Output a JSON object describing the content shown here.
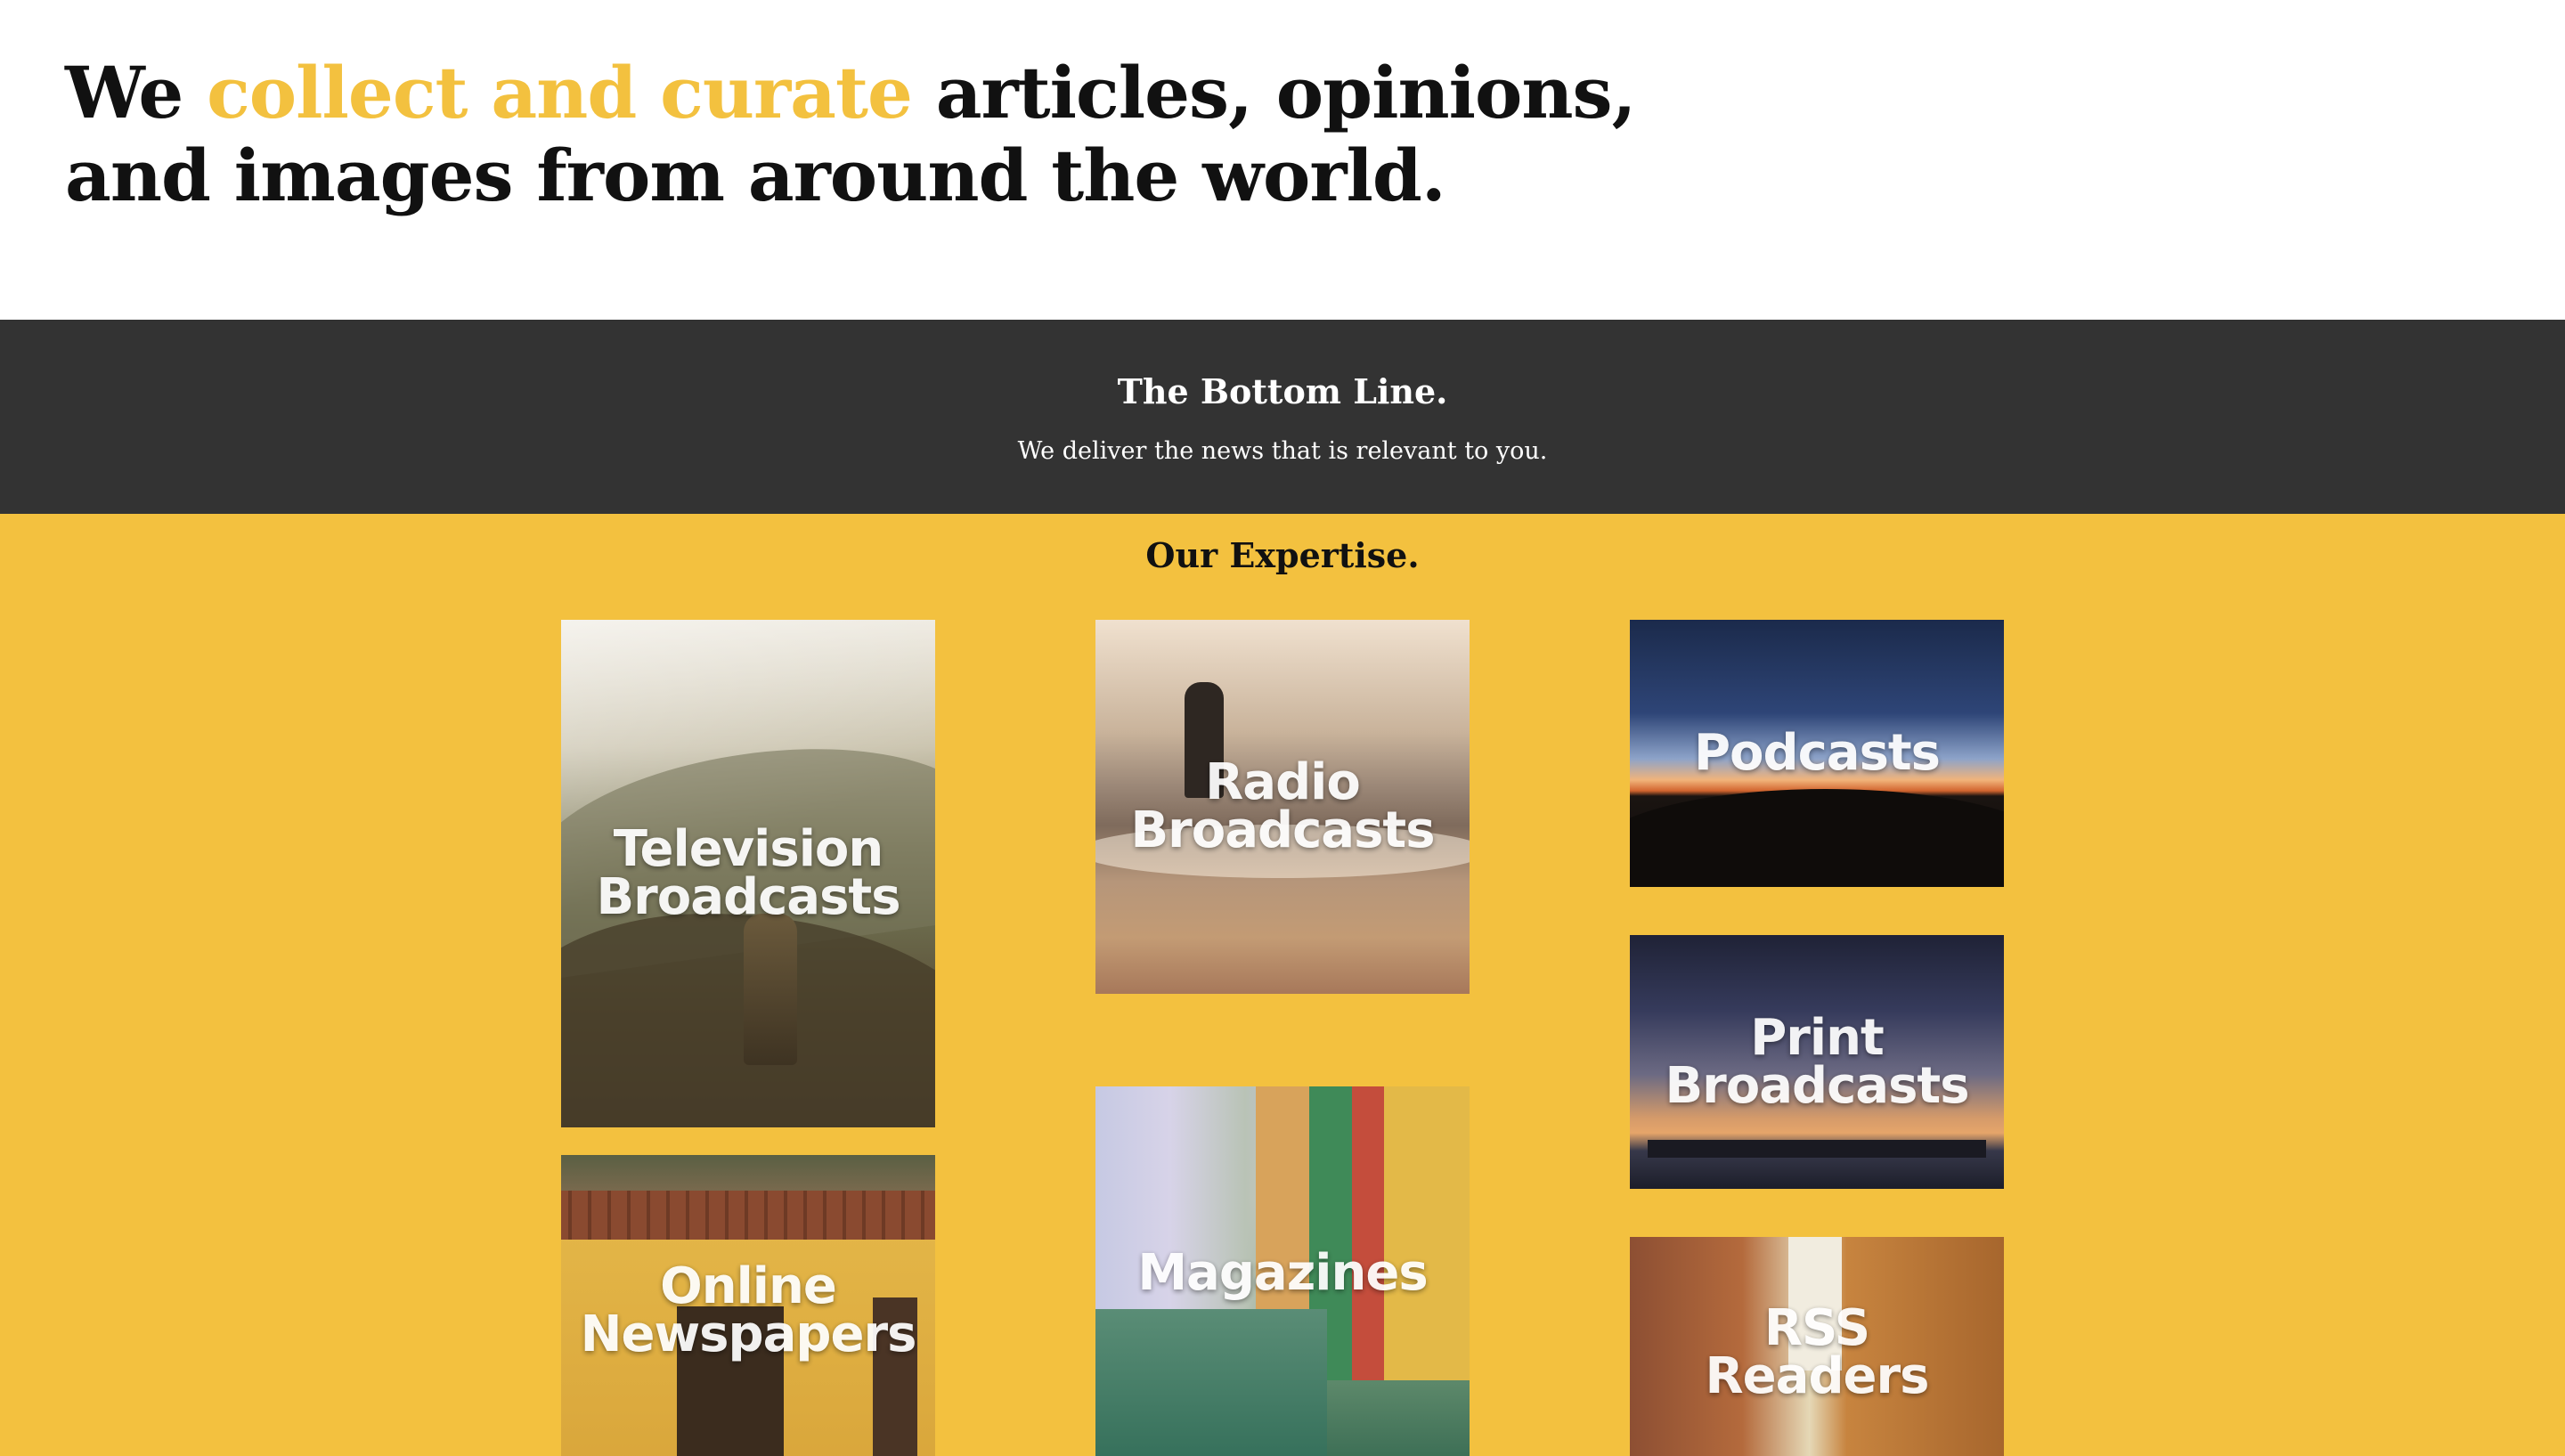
{
  "hero": {
    "prefix": "We ",
    "accent": "collect and curate",
    "suffix": " articles, opinions, and images from around the world.",
    "accent_color": "#f3c13f"
  },
  "bottom_line": {
    "title": "The Bottom Line.",
    "subtitle": "We deliver the news that is relevant to you.",
    "background": "#333333"
  },
  "expertise": {
    "title": "Our Expertise.",
    "background": "#f3c13f",
    "tiles": [
      {
        "label": "Television\nBroadcasts",
        "image": "hiker-mountains"
      },
      {
        "label": "Radio\nBroadcasts",
        "image": "man-on-shore"
      },
      {
        "label": "Podcasts",
        "image": "sunset-silhouette"
      },
      {
        "label": "Print\nBroadcasts",
        "image": "pier-at-dusk"
      },
      {
        "label": "Online\nNewspapers",
        "image": "yellow-building"
      },
      {
        "label": "Magazines",
        "image": "canal-houses"
      },
      {
        "label": "RSS\nReaders",
        "image": "narrow-alley"
      }
    ]
  }
}
